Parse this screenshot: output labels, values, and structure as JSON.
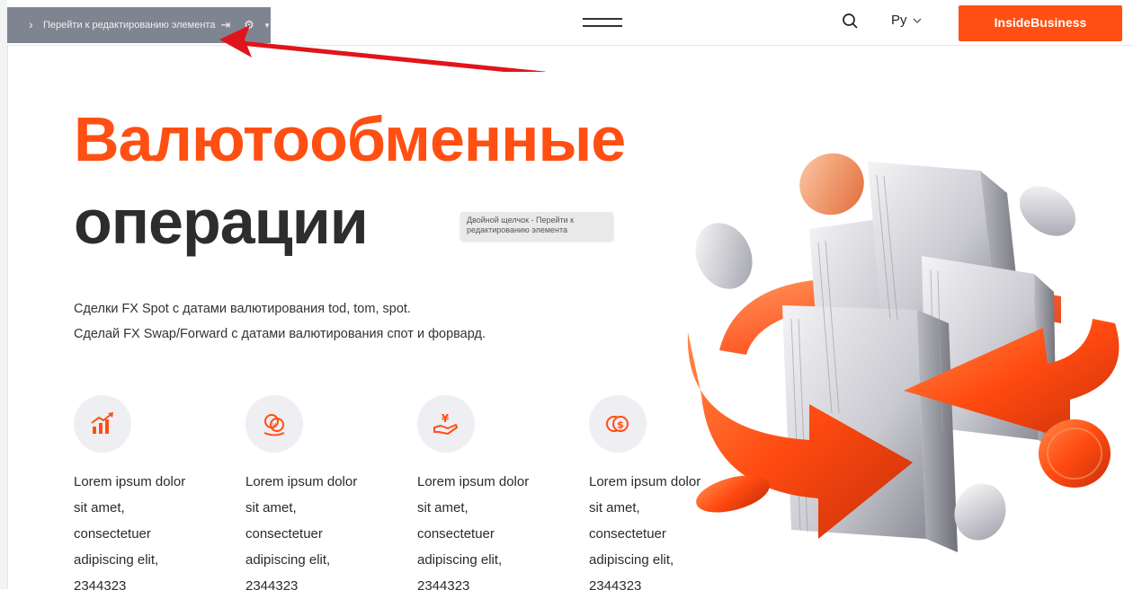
{
  "editor_toolbar": {
    "label": "Перейти к редактированию элемента"
  },
  "header": {
    "lang": "Ру",
    "cta_label": "InsideBusiness"
  },
  "hero": {
    "title_line1": "Валютообменные",
    "title_line2": "операции",
    "tooltip": "Двойной щелчок - Перейти к редактированию элемента",
    "subtitle_line1": "Сделки FX Spot с датами валютирования tod, tom, spot.",
    "subtitle_line2": "Сделай FX Swap/Forward с датами валютирования спот и форвард."
  },
  "features": [
    {
      "icon": "growth-chart-icon",
      "line1": "Lorem ipsum dolor",
      "line2": "sit amet,",
      "line3": "consectetuer",
      "line4": "adipiscing elit,",
      "line5": "2344323"
    },
    {
      "icon": "currency-exchange-icon",
      "line1": "Lorem ipsum dolor",
      "line2": "sit amet,",
      "line3": "consectetuer",
      "line4": "adipiscing elit,",
      "line5": "2344323"
    },
    {
      "icon": "yen-hand-icon",
      "line1": "Lorem ipsum dolor",
      "line2": "sit amet,",
      "line3": "consectetuer",
      "line4": "adipiscing elit,",
      "line5": "2344323"
    },
    {
      "icon": "coins-dollar-icon",
      "line1": "Lorem ipsum dolor",
      "line2": "sit amet,",
      "line3": "consectetuer",
      "line4": "adipiscing elit,",
      "line5": "2344323"
    }
  ],
  "colors": {
    "accent": "#ff4f12",
    "toolbar": "#7f8590",
    "icon_circle": "#eeeef3",
    "annotation_arrow": "#e0151b"
  }
}
